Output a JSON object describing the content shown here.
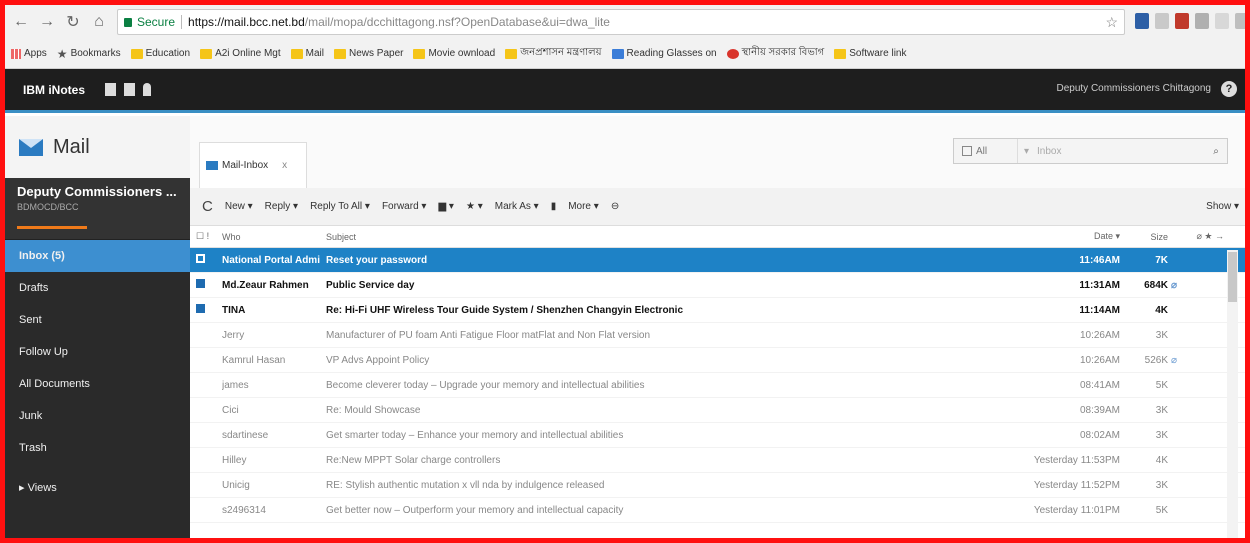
{
  "browser": {
    "secure_label": "Secure",
    "url_host": "https://mail.bcc.net.bd",
    "url_path": "/mail/mopa/dcchittagong.nsf?OpenDatabase&ui=dwa_lite",
    "bookmarks": [
      {
        "label": "Apps",
        "icon": "apps-grid-icon"
      },
      {
        "label": "Bookmarks",
        "icon": "star-icon"
      },
      {
        "label": "Education",
        "icon": "folder-icon"
      },
      {
        "label": "A2i Online Mgt",
        "icon": "folder-icon"
      },
      {
        "label": "Mail",
        "icon": "folder-icon"
      },
      {
        "label": "News Paper",
        "icon": "folder-icon"
      },
      {
        "label": "Movie ownload",
        "icon": "folder-icon"
      },
      {
        "label": "জনপ্রশাসন মন্ত্রণালয়",
        "icon": "folder-icon"
      },
      {
        "label": "Reading Glasses on",
        "icon": "folder-icon"
      },
      {
        "label": "স্থানীয় সরকার বিভাগ",
        "icon": "folder-icon"
      },
      {
        "label": "Software link",
        "icon": "folder-icon"
      }
    ]
  },
  "app": {
    "brand": "IBM iNotes",
    "user_menu": "Deputy Commissioners Chittagong",
    "section_title": "Mail",
    "account_name": "Deputy Commissioners ...",
    "account_sub": "BDMOCD/BCC"
  },
  "nav": [
    {
      "label": "Inbox (5)",
      "selected": true
    },
    {
      "label": "Drafts"
    },
    {
      "label": "Sent"
    },
    {
      "label": "Follow Up"
    },
    {
      "label": "All Documents"
    },
    {
      "label": "Junk"
    },
    {
      "label": "Trash"
    }
  ],
  "nav_views": "Views",
  "tab": {
    "label": "Mail-Inbox",
    "close": "x"
  },
  "search": {
    "scope": "All",
    "placeholder": "Inbox"
  },
  "toolbar": {
    "new": "New",
    "reply": "Reply",
    "reply_all": "Reply To All",
    "forward": "Forward",
    "mark_as": "Mark As",
    "more": "More",
    "show": "Show"
  },
  "columns": {
    "who": "Who",
    "subject": "Subject",
    "date": "Date",
    "size": "Size"
  },
  "messages": [
    {
      "who": "National Portal Admi",
      "subject": "Reset your password",
      "date": "11:46AM",
      "size": "7K",
      "state": "selected"
    },
    {
      "who": "Md.Zeaur Rahmen",
      "subject": "Public Service day",
      "date": "11:31AM",
      "size": "684K",
      "state": "unread",
      "attachment": true
    },
    {
      "who": "TINA",
      "subject": "Re: Hi-Fi UHF Wireless Tour Guide System / Shenzhen Changyin Electronic",
      "date": "11:14AM",
      "size": "4K",
      "state": "unread"
    },
    {
      "who": "Jerry",
      "subject": "Manufacturer of PU foam Anti Fatigue Floor matFlat and Non Flat version",
      "date": "10:26AM",
      "size": "3K",
      "state": "read"
    },
    {
      "who": "Kamrul Hasan",
      "subject": "VP Advs Appoint Policy",
      "date": "10:26AM",
      "size": "526K",
      "state": "read",
      "attachment": true
    },
    {
      "who": "james",
      "subject": "Become cleverer today – Upgrade your memory and intellectual abilities",
      "date": "08:41AM",
      "size": "5K",
      "state": "read"
    },
    {
      "who": "Cici",
      "subject": "Re: Mould Showcase",
      "date": "08:39AM",
      "size": "3K",
      "state": "read"
    },
    {
      "who": "sdartinese",
      "subject": "Get smarter today – Enhance your memory and intellectual abilities",
      "date": "08:02AM",
      "size": "3K",
      "state": "read"
    },
    {
      "who": "Hilley",
      "subject": "Re:New MPPT Solar charge controllers",
      "date": "Yesterday 11:53PM",
      "size": "4K",
      "state": "read"
    },
    {
      "who": "Unicig",
      "subject": "RE: Stylish authentic mutation x vll nda by indulgence released",
      "date": "Yesterday 11:52PM",
      "size": "3K",
      "state": "read"
    },
    {
      "who": "s2496314",
      "subject": "Get better now – Outperform your memory and intellectual capacity",
      "date": "Yesterday 11:01PM",
      "size": "5K",
      "state": "read"
    }
  ]
}
